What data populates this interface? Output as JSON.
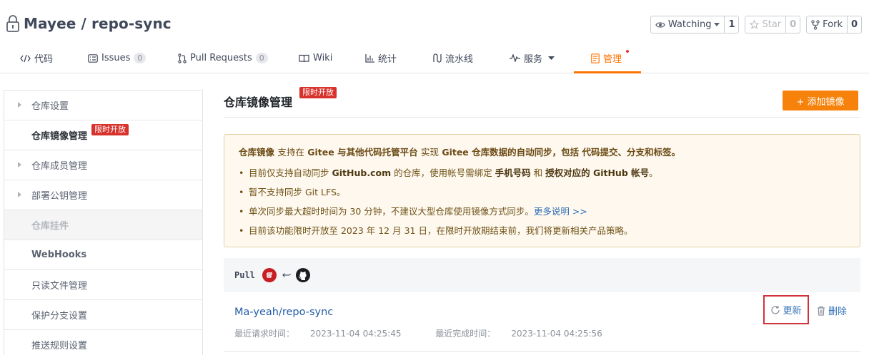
{
  "repo": {
    "owner": "Mayee",
    "separator": "/",
    "name": "repo-sync"
  },
  "actions": {
    "watch": {
      "label": "Watching",
      "count": "1"
    },
    "star": {
      "label": "Star",
      "count": "0"
    },
    "fork": {
      "label": "Fork",
      "count": "0"
    }
  },
  "tabs": [
    {
      "label": "代码",
      "icon": "code-icon"
    },
    {
      "label": "Issues",
      "badge": "0",
      "icon": "issues-icon"
    },
    {
      "label": "Pull Requests",
      "badge": "0",
      "icon": "pull-request-icon"
    },
    {
      "label": "Wiki",
      "icon": "wiki-icon"
    },
    {
      "label": "统计",
      "icon": "chart-icon"
    },
    {
      "label": "流水线",
      "icon": "pipeline-icon"
    },
    {
      "label": "服务",
      "icon": "pulse-icon"
    },
    {
      "label": "管理",
      "icon": "manage-icon",
      "active": true
    }
  ],
  "sidebar": {
    "items": [
      {
        "label": "仓库设置"
      },
      {
        "label": "仓库镜像管理",
        "badge": "限时开放"
      },
      {
        "label": "仓库成员管理"
      },
      {
        "label": "部署公钥管理"
      },
      {
        "label": "仓库挂件"
      },
      {
        "label": "WebHooks"
      },
      {
        "label": "只读文件管理"
      },
      {
        "label": "保护分支设置"
      },
      {
        "label": "推送规则设置"
      }
    ]
  },
  "main": {
    "title": "仓库镜像管理",
    "title_badge": "限时开放",
    "add_button": "+ 添加镜像"
  },
  "notice": {
    "head_1": "仓库镜像",
    "head_2": "支持在",
    "head_3": "Gitee 与其他代码托管平台",
    "head_4": "实现",
    "head_5": "Gitee 仓库数据的自动同步，包括",
    "head_6": "代码提交、分支和标签。",
    "li1_a": "目前仅支持自动同步",
    "li1_b": "GitHub.com",
    "li1_c": "的仓库，使用帐号需绑定",
    "li1_d": "手机号码",
    "li1_e": "和",
    "li1_f": "授权对应的 GitHub 帐号",
    "li1_g": "。",
    "li2": "暂不支持同步 Git LFS。",
    "li3": "单次同步最大超时时间为 30 分钟，不建议大型仓库使用镜像方式同步。",
    "li3_link": "更多说明 >>",
    "li4": "目前该功能限时开放至 2023 年 12 月 31 日，在限时开放期结束前，我们将更新相关产品策略。"
  },
  "mirror": {
    "direction_label": "Pull",
    "repo": "Ma-yeah/repo-sync",
    "last_request_label": "最近请求时间：",
    "last_request": "2023-11-04 04:25:45",
    "last_complete_label": "最近完成时间：",
    "last_complete": "2023-11-04 04:25:56",
    "update_label": "更新",
    "delete_label": "删除"
  },
  "colors": {
    "accent": "#fe7300",
    "badge_red": "#d8322d",
    "link": "#2e6fb8"
  }
}
